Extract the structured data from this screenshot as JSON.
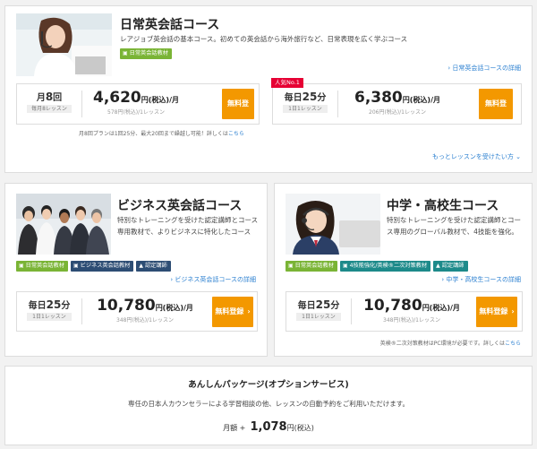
{
  "daily": {
    "title": "日常英会話コース",
    "description": "レアジョブ英会話の基本コース。初めての英会話から海外旅行など、日常表現を広く学ぶコース",
    "tag": "日常英会話教材",
    "detail_link": "日常英会話コースの詳細",
    "plans": [
      {
        "freq_prefix": "月",
        "freq_num": "8",
        "freq_suffix": "回",
        "freq_sub": "毎月8レッスン",
        "price": "4,620",
        "unit": "円(税込)/月",
        "per": "578円(税込)/1レッスン",
        "button": "無料登録"
      },
      {
        "badge": "人気No.1",
        "freq_prefix": "毎日",
        "freq_num": "25",
        "freq_suffix": "分",
        "freq_sub": "1日1レッスン",
        "price": "6,380",
        "unit": "円(税込)/月",
        "per": "206円(税込)/1レッスン",
        "button": "無料登録"
      }
    ],
    "note_text": "月8回プランは1回25分、最大20回まで繰越し可能！詳しくは",
    "note_link": "こちら",
    "more_link": "もっとレッスンを受けたい方"
  },
  "business": {
    "title": "ビジネス英会話コース",
    "description": "特別なトレーニングを受けた認定講師とコース専用教材で、よりビジネスに特化したコース",
    "tags": [
      "日常英会話教材",
      "ビジネス英会話教材",
      "認定講師"
    ],
    "detail_link": "ビジネス英会話コースの詳細",
    "plan": {
      "freq_prefix": "毎日",
      "freq_num": "25",
      "freq_suffix": "分",
      "freq_sub": "1日1レッスン",
      "price": "10,780",
      "unit": "円(税込)/月",
      "per": "348円(税込)/1レッスン",
      "button": "無料登録"
    }
  },
  "student": {
    "title": "中学・高校生コース",
    "description": "特別なトレーニングを受けた認定講師とコース専用のグローバル教材で、4技能を強化。",
    "tags": [
      "日常英会話教材",
      "4技能強化/英検®二次対策教材",
      "認定講師"
    ],
    "detail_link": "中学・高校生コースの詳細",
    "plan": {
      "freq_prefix": "毎日",
      "freq_num": "25",
      "freq_suffix": "分",
      "freq_sub": "1日1レッスン",
      "price": "10,780",
      "unit": "円(税込)/月",
      "per": "348円(税込)/1レッスン",
      "button": "無料登録"
    },
    "note_text": "英検®二次対策教材はPC環境が必要です。詳しくは",
    "note_link": "こちら"
  },
  "package": {
    "title": "あんしんパッケージ(オプションサービス)",
    "description": "専任の日本人カウンセラーによる学習相談の他、レッスンの自動予約をご利用いただけます。",
    "price_prefix": "月額 +",
    "price": "1,078",
    "price_unit": "円(税込)"
  },
  "colors": {
    "accent": "#f39800",
    "green_tag": "#7ab435",
    "navy_tag": "#2d4d74",
    "teal_tag": "#1d8a8a",
    "badge": "#e60033",
    "link": "#2a7fd0"
  }
}
